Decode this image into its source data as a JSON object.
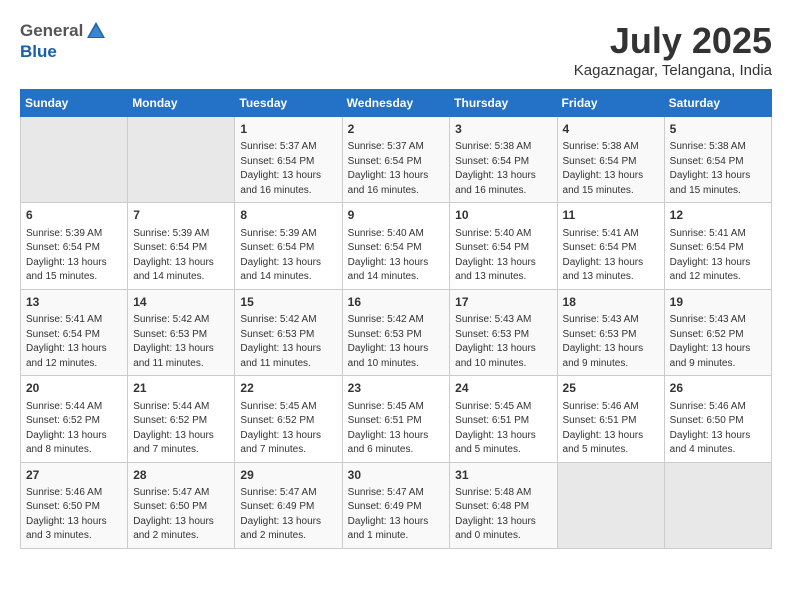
{
  "header": {
    "logo_general": "General",
    "logo_blue": "Blue",
    "month_title": "July 2025",
    "subtitle": "Kagaznagar, Telangana, India"
  },
  "weekdays": [
    "Sunday",
    "Monday",
    "Tuesday",
    "Wednesday",
    "Thursday",
    "Friday",
    "Saturday"
  ],
  "weeks": [
    [
      {
        "day": "",
        "info": ""
      },
      {
        "day": "",
        "info": ""
      },
      {
        "day": "1",
        "info": "Sunrise: 5:37 AM\nSunset: 6:54 PM\nDaylight: 13 hours\nand 16 minutes."
      },
      {
        "day": "2",
        "info": "Sunrise: 5:37 AM\nSunset: 6:54 PM\nDaylight: 13 hours\nand 16 minutes."
      },
      {
        "day": "3",
        "info": "Sunrise: 5:38 AM\nSunset: 6:54 PM\nDaylight: 13 hours\nand 16 minutes."
      },
      {
        "day": "4",
        "info": "Sunrise: 5:38 AM\nSunset: 6:54 PM\nDaylight: 13 hours\nand 15 minutes."
      },
      {
        "day": "5",
        "info": "Sunrise: 5:38 AM\nSunset: 6:54 PM\nDaylight: 13 hours\nand 15 minutes."
      }
    ],
    [
      {
        "day": "6",
        "info": "Sunrise: 5:39 AM\nSunset: 6:54 PM\nDaylight: 13 hours\nand 15 minutes."
      },
      {
        "day": "7",
        "info": "Sunrise: 5:39 AM\nSunset: 6:54 PM\nDaylight: 13 hours\nand 14 minutes."
      },
      {
        "day": "8",
        "info": "Sunrise: 5:39 AM\nSunset: 6:54 PM\nDaylight: 13 hours\nand 14 minutes."
      },
      {
        "day": "9",
        "info": "Sunrise: 5:40 AM\nSunset: 6:54 PM\nDaylight: 13 hours\nand 14 minutes."
      },
      {
        "day": "10",
        "info": "Sunrise: 5:40 AM\nSunset: 6:54 PM\nDaylight: 13 hours\nand 13 minutes."
      },
      {
        "day": "11",
        "info": "Sunrise: 5:41 AM\nSunset: 6:54 PM\nDaylight: 13 hours\nand 13 minutes."
      },
      {
        "day": "12",
        "info": "Sunrise: 5:41 AM\nSunset: 6:54 PM\nDaylight: 13 hours\nand 12 minutes."
      }
    ],
    [
      {
        "day": "13",
        "info": "Sunrise: 5:41 AM\nSunset: 6:54 PM\nDaylight: 13 hours\nand 12 minutes."
      },
      {
        "day": "14",
        "info": "Sunrise: 5:42 AM\nSunset: 6:53 PM\nDaylight: 13 hours\nand 11 minutes."
      },
      {
        "day": "15",
        "info": "Sunrise: 5:42 AM\nSunset: 6:53 PM\nDaylight: 13 hours\nand 11 minutes."
      },
      {
        "day": "16",
        "info": "Sunrise: 5:42 AM\nSunset: 6:53 PM\nDaylight: 13 hours\nand 10 minutes."
      },
      {
        "day": "17",
        "info": "Sunrise: 5:43 AM\nSunset: 6:53 PM\nDaylight: 13 hours\nand 10 minutes."
      },
      {
        "day": "18",
        "info": "Sunrise: 5:43 AM\nSunset: 6:53 PM\nDaylight: 13 hours\nand 9 minutes."
      },
      {
        "day": "19",
        "info": "Sunrise: 5:43 AM\nSunset: 6:52 PM\nDaylight: 13 hours\nand 9 minutes."
      }
    ],
    [
      {
        "day": "20",
        "info": "Sunrise: 5:44 AM\nSunset: 6:52 PM\nDaylight: 13 hours\nand 8 minutes."
      },
      {
        "day": "21",
        "info": "Sunrise: 5:44 AM\nSunset: 6:52 PM\nDaylight: 13 hours\nand 7 minutes."
      },
      {
        "day": "22",
        "info": "Sunrise: 5:45 AM\nSunset: 6:52 PM\nDaylight: 13 hours\nand 7 minutes."
      },
      {
        "day": "23",
        "info": "Sunrise: 5:45 AM\nSunset: 6:51 PM\nDaylight: 13 hours\nand 6 minutes."
      },
      {
        "day": "24",
        "info": "Sunrise: 5:45 AM\nSunset: 6:51 PM\nDaylight: 13 hours\nand 5 minutes."
      },
      {
        "day": "25",
        "info": "Sunrise: 5:46 AM\nSunset: 6:51 PM\nDaylight: 13 hours\nand 5 minutes."
      },
      {
        "day": "26",
        "info": "Sunrise: 5:46 AM\nSunset: 6:50 PM\nDaylight: 13 hours\nand 4 minutes."
      }
    ],
    [
      {
        "day": "27",
        "info": "Sunrise: 5:46 AM\nSunset: 6:50 PM\nDaylight: 13 hours\nand 3 minutes."
      },
      {
        "day": "28",
        "info": "Sunrise: 5:47 AM\nSunset: 6:50 PM\nDaylight: 13 hours\nand 2 minutes."
      },
      {
        "day": "29",
        "info": "Sunrise: 5:47 AM\nSunset: 6:49 PM\nDaylight: 13 hours\nand 2 minutes."
      },
      {
        "day": "30",
        "info": "Sunrise: 5:47 AM\nSunset: 6:49 PM\nDaylight: 13 hours\nand 1 minute."
      },
      {
        "day": "31",
        "info": "Sunrise: 5:48 AM\nSunset: 6:48 PM\nDaylight: 13 hours\nand 0 minutes."
      },
      {
        "day": "",
        "info": ""
      },
      {
        "day": "",
        "info": ""
      }
    ]
  ]
}
